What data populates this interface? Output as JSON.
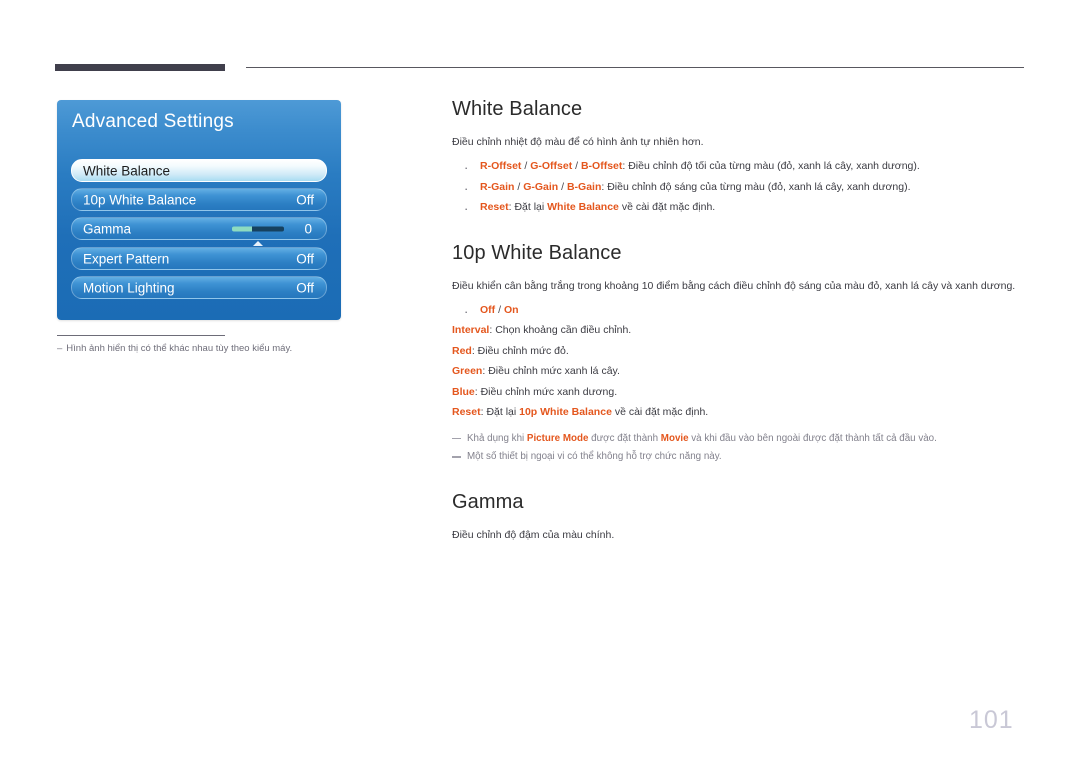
{
  "header": {
    "rule_thick": true,
    "rule_thin": true
  },
  "osd": {
    "title": "Advanced Settings",
    "scroll_up_icon": "triangle-up-icon",
    "rows": [
      {
        "label": "White Balance",
        "value": "",
        "selected": true,
        "type": "item"
      },
      {
        "label": "10p White Balance",
        "value": "Off",
        "selected": false,
        "type": "item"
      },
      {
        "label": "Gamma",
        "value": "0",
        "selected": false,
        "type": "slider",
        "slider_fill_percent": 38
      },
      {
        "label": "Expert Pattern",
        "value": "Off",
        "selected": false,
        "type": "item"
      },
      {
        "label": "Motion Lighting",
        "value": "Off",
        "selected": false,
        "type": "item"
      }
    ],
    "note_dash": "‒",
    "note": "Hình ảnh hiển thị có thể khác nhau tùy theo kiểu máy."
  },
  "content": {
    "white_balance": {
      "title": "White Balance",
      "lead": "Điều chỉnh nhiệt độ màu để có hình ảnh tự nhiên hơn.",
      "bullets": [
        {
          "terms": [
            "R-Offset",
            "G-Offset",
            "B-Offset"
          ],
          "sep": " / ",
          "rest": ": Điều chỉnh độ tối của từng màu (đỏ, xanh lá cây, xanh dương)."
        },
        {
          "terms": [
            "R-Gain",
            "G-Gain",
            "B-Gain"
          ],
          "sep": " / ",
          "rest": ": Điều chỉnh độ sáng của từng màu (đỏ, xanh lá cây, xanh dương)."
        }
      ],
      "reset_bullet": {
        "term": "Reset",
        "mid": ": Đặt lại ",
        "term2": "White Balance",
        "rest": " về cài đặt mặc định."
      }
    },
    "tenp_white_balance": {
      "title": "10p White Balance",
      "lead": "Điều khiển cân bằng trắng trong khoảng 10 điểm bằng cách điều chỉnh độ sáng của màu đỏ, xanh lá cây và xanh dương.",
      "onoff_bullet": {
        "off": "Off",
        "sep": " / ",
        "on": "On"
      },
      "lines": [
        {
          "term": "Interval",
          "rest": ": Chọn khoảng cần điều chỉnh."
        },
        {
          "term": "Red",
          "rest": ": Điều chỉnh mức đỏ."
        },
        {
          "term": "Green",
          "rest": ": Điều chỉnh mức xanh lá cây."
        },
        {
          "term": "Blue",
          "rest": ": Điều chỉnh mức xanh dương."
        }
      ],
      "reset_line": {
        "term": "Reset",
        "mid": ": Đặt lại ",
        "term2": "10p White Balance",
        "rest": " về cài đặt mặc định."
      },
      "notes": [
        {
          "pre": "Khả dụng khi ",
          "term1": "Picture Mode",
          "mid": " được đặt thành ",
          "term2": "Movie",
          "post": " và khi đầu vào bên ngoài được đặt thành tất cả đầu vào."
        },
        {
          "pre": "Một số thiết bị ngoại vi có thể không hỗ trợ chức năng này.",
          "term1": "",
          "mid": "",
          "term2": "",
          "post": ""
        }
      ]
    },
    "gamma": {
      "title": "Gamma",
      "lead": "Điều chỉnh độ đậm của màu chính."
    }
  },
  "page_number": "101",
  "colors": {
    "accent_orange": "#e4571e",
    "osd_blue": "#2a7cc2",
    "text": "#3b3b42",
    "note_gray": "#82818c",
    "page_number": "#c9c8d6"
  }
}
